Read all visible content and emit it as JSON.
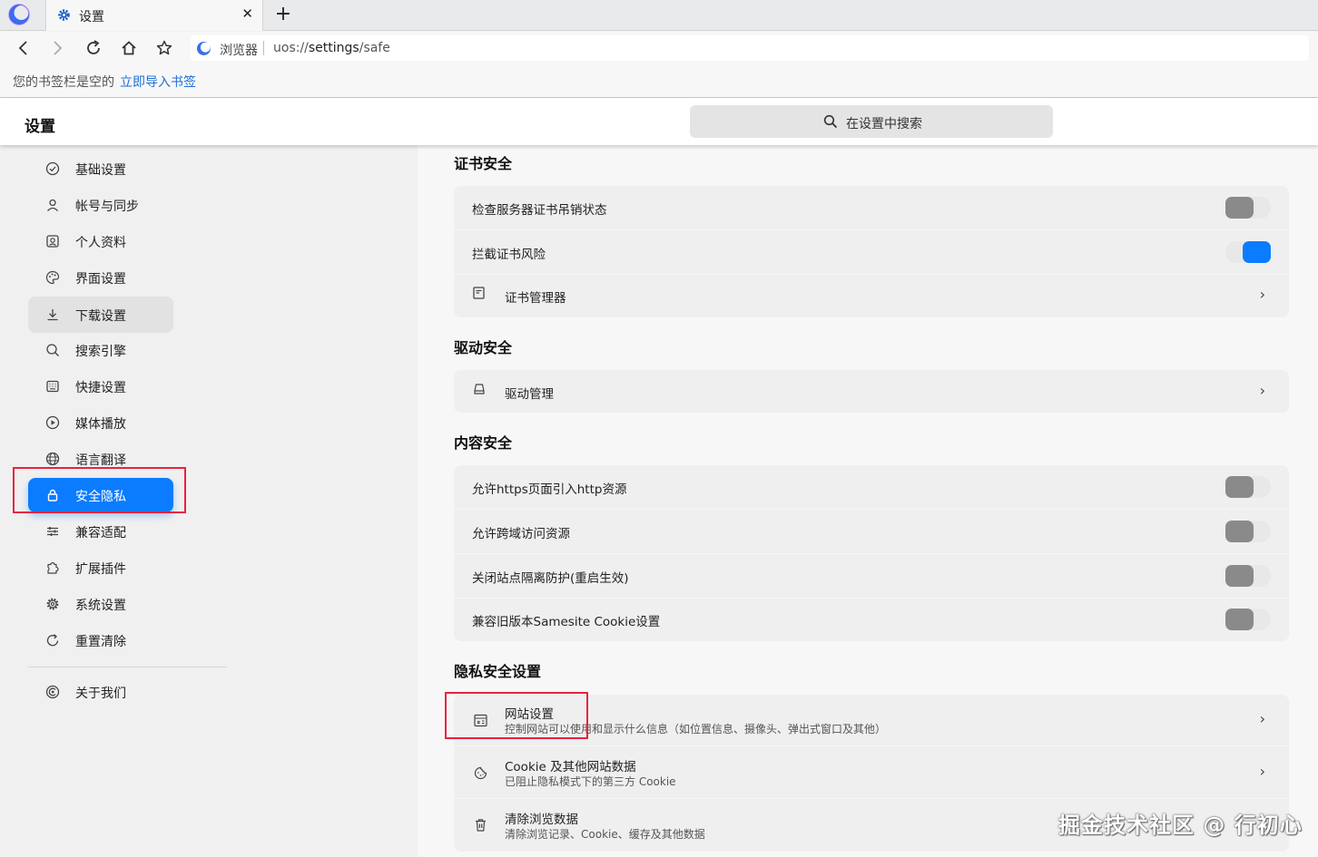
{
  "browser": {
    "tab": {
      "title": "设置",
      "close": "✕"
    },
    "new_tab": "+",
    "address": {
      "site": "浏览器",
      "url_scheme": "uos://",
      "url_host": "settings",
      "url_path": "/safe"
    },
    "bookmarks": {
      "empty_text": "您的书签栏是空的",
      "import_link": "立即导入书签"
    }
  },
  "header": {
    "title": "设置",
    "search_placeholder": "在设置中搜索"
  },
  "sidebar": {
    "items": [
      {
        "label": "基础设置",
        "icon": "check-circle-icon"
      },
      {
        "label": "帐号与同步",
        "icon": "user-icon"
      },
      {
        "label": "个人资料",
        "icon": "profile-icon"
      },
      {
        "label": "界面设置",
        "icon": "palette-icon"
      },
      {
        "label": "下载设置",
        "icon": "download-icon"
      },
      {
        "label": "搜索引擎",
        "icon": "search-icon"
      },
      {
        "label": "快捷设置",
        "icon": "keyboard-icon"
      },
      {
        "label": "媒体播放",
        "icon": "play-icon"
      },
      {
        "label": "语言翻译",
        "icon": "globe-icon"
      },
      {
        "label": "安全隐私",
        "icon": "lock-icon"
      },
      {
        "label": "兼容适配",
        "icon": "sliders-icon"
      },
      {
        "label": "扩展插件",
        "icon": "puzzle-icon"
      },
      {
        "label": "系统设置",
        "icon": "gear-icon"
      },
      {
        "label": "重置清除",
        "icon": "reset-icon"
      }
    ],
    "about": {
      "label": "关于我们",
      "icon": "about-icon"
    },
    "active": "安全隐私",
    "hovered": "下载设置"
  },
  "sections": {
    "cert": {
      "title": "证书安全",
      "check_revocation": {
        "label": "检查服务器证书吊销状态",
        "on": false
      },
      "block_risk": {
        "label": "拦截证书风险",
        "on": true
      },
      "cert_manager": {
        "label": "证书管理器"
      }
    },
    "driver": {
      "title": "驱动安全",
      "driver_manager": {
        "label": "驱动管理"
      }
    },
    "content": {
      "title": "内容安全",
      "allow_https_http": {
        "label": "允许https页面引入http资源",
        "on": false
      },
      "allow_cross_domain": {
        "label": "允许跨域访问资源",
        "on": false
      },
      "disable_site_isolation": {
        "label": "关闭站点隔离防护(重启生效)",
        "on": false
      },
      "legacy_samesite": {
        "label": "兼容旧版本Samesite Cookie设置",
        "on": false
      }
    },
    "privacy": {
      "title": "隐私安全设置",
      "site_settings": {
        "label": "网站设置",
        "sub": "控制网站可以使用和显示什么信息（如位置信息、摄像头、弹出式窗口及其他）"
      },
      "cookies": {
        "label": "Cookie 及其他网站数据",
        "sub": "已阻止隐私模式下的第三方 Cookie"
      },
      "clear_data": {
        "label": "清除浏览数据",
        "sub": "清除浏览记录、Cookie、缓存及其他数据"
      }
    }
  },
  "chevron": "›",
  "watermark": "掘金技术社区 @ 行初心",
  "colors": {
    "accent": "#0b7cff",
    "highlight_box": "#e8223f",
    "link": "#1d6fd8"
  }
}
